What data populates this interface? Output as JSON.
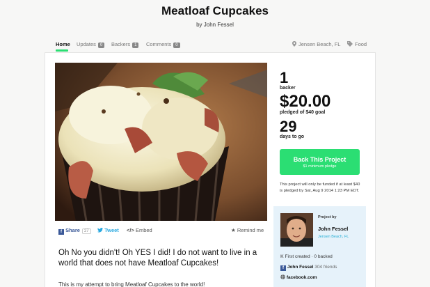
{
  "project": {
    "title": "Meatloaf Cupcakes",
    "byline": "by John Fessel",
    "pitch": "Oh No you didn't! Oh YES I did! I do not want to live in a world that does not have Meatloaf Cupcakes!",
    "pitch_more": "This is my attempt to bring Meatloaf Cupcakes to the world!"
  },
  "nav": {
    "home": "Home",
    "updates": "Updates",
    "updates_count": "0",
    "backers": "Backers",
    "backers_count": "1",
    "comments": "Comments",
    "comments_count": "0",
    "location": "Jensen Beach, FL",
    "category": "Food"
  },
  "stats": {
    "backers_value": "1",
    "backers_label": "backer",
    "pledged_value": "$20.00",
    "pledged_label": "pledged of $40 goal",
    "days_value": "29",
    "days_label": "days to go"
  },
  "cta": {
    "label": "Back This Project",
    "sub": "$1 minimum pledge",
    "note": "This project will only be funded if at least $40 is pledged by Sat, Aug 9 2014 1:23 PM EDT."
  },
  "share": {
    "fb_label": "Share",
    "fb_count": "27",
    "tweet_label": "Tweet",
    "embed_label": "Embed",
    "remind_label": "Remind me"
  },
  "creator": {
    "label": "Project by",
    "name": "John Fessel",
    "location": "Jensen Beach, FL",
    "first_created": "First created · 0 backed",
    "fb_name": "John Fessel",
    "fb_friends": "304 friends",
    "website": "facebook.com"
  },
  "colors": {
    "accent": "#2bde73",
    "link": "#2bb0d6",
    "facebook": "#3b5998"
  },
  "icons": [
    "location-pin-icon",
    "tag-icon",
    "facebook-icon",
    "twitter-icon",
    "embed-icon",
    "star-icon",
    "kickstarter-icon",
    "globe-icon"
  ]
}
